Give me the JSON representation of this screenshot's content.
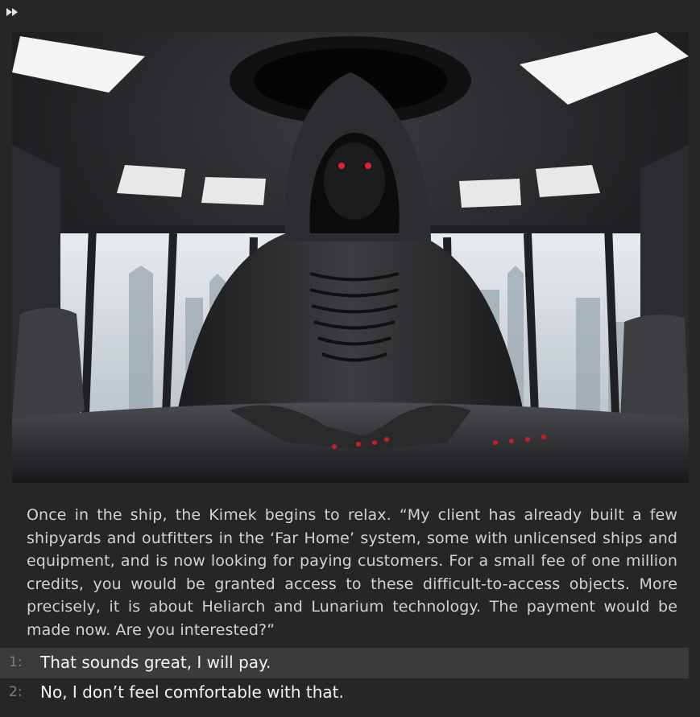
{
  "toolbar": {
    "fast_forward_icon": "fast-forward-icon"
  },
  "scene": {
    "description_icon": "scene-image"
  },
  "narration": "Once in the ship, the Kimek begins to relax. “My client has already built a few shipyards and outfitters in the ‘Far Home’ system, some with unlicensed ships and equipment, and is now looking for paying customers. For a small fee of one million credits, you would be granted access to these difficult-to-access objects. More precisely, it is about Heliarch and Lunarium technology. The payment would be made now. Are you interested?”",
  "choices": [
    {
      "num": "1:",
      "text": "That sounds great, I will pay.",
      "selected": true
    },
    {
      "num": "2:",
      "text": "No, I don’t feel comfortable with that.",
      "selected": false
    }
  ],
  "colors": {
    "background": "#262626",
    "selected_row": "#3b3b3b",
    "text": "#d2d2d2",
    "choice_text": "#f2f2f2"
  }
}
